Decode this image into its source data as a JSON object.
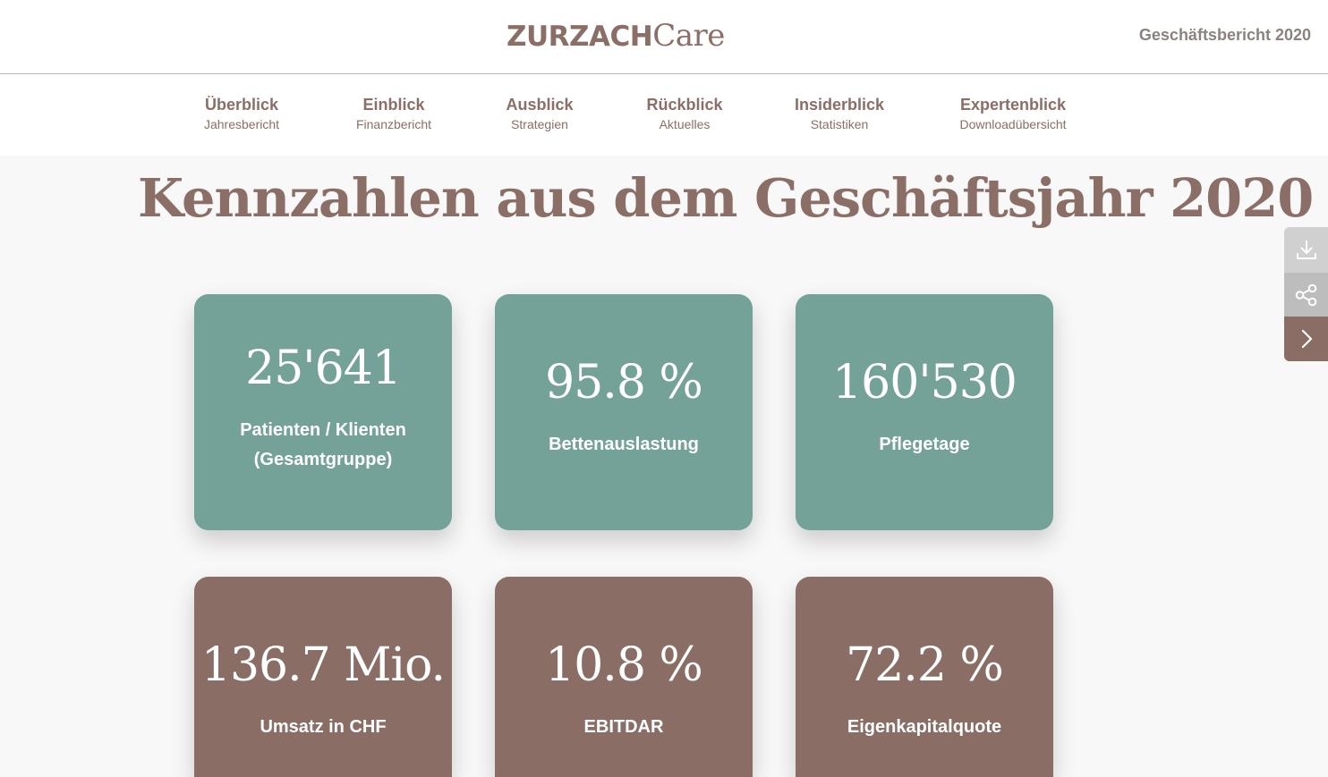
{
  "header": {
    "logo_bold": "ZURZACH",
    "logo_light": "Care",
    "report_title": "Geschäftsbericht 2020"
  },
  "nav": {
    "items": [
      {
        "main": "Überblick",
        "sub": "Jahresbericht"
      },
      {
        "main": "Einblick",
        "sub": "Finanzbericht"
      },
      {
        "main": "Ausblick",
        "sub": "Strategien"
      },
      {
        "main": "Rückblick",
        "sub": "Aktuelles"
      },
      {
        "main": "Insiderblick",
        "sub": "Statistiken"
      },
      {
        "main": "Expertenblick",
        "sub": "Downloadübersicht"
      }
    ]
  },
  "page": {
    "headline": "Kennzahlen aus dem Geschäftsjahr 2020"
  },
  "cards": [
    {
      "value": "25'641",
      "label": "Patienten / Klienten (Gesamtgruppe)"
    },
    {
      "value": "95.8 %",
      "label": "Bettenauslastung"
    },
    {
      "value": "160'530",
      "label": "Pflegetage"
    },
    {
      "value": "136.7 Mio.",
      "label": "Umsatz in CHF"
    },
    {
      "value": "10.8 %",
      "label": "EBITDAR"
    },
    {
      "value": "72.2 %",
      "label": "Eigenkapitalquote"
    }
  ],
  "side_tools": {
    "icons": [
      "download-icon",
      "share-icon",
      "chevron-right-icon"
    ]
  },
  "colors": {
    "brand_brown": "#8a6d64",
    "card_green": "#74a198",
    "background": "#f8f8f8"
  }
}
